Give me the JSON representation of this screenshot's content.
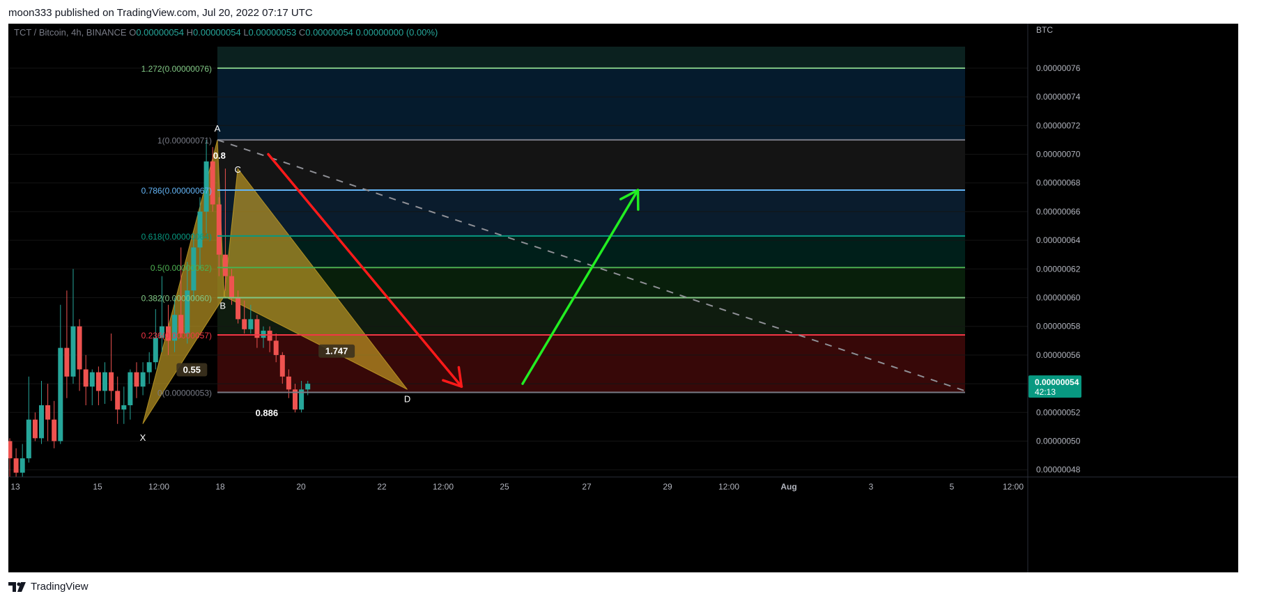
{
  "header": {
    "published": "moon333 published on TradingView.com, Jul 20, 2022 07:17 UTC"
  },
  "footer": {
    "brand": "TradingView"
  },
  "legend": {
    "symbol": "TCT / Bitcoin, 4h, BINANCE",
    "o_label": "O",
    "o_value": "0.00000054",
    "h_label": "H",
    "h_value": "0.00000054",
    "l_label": "L",
    "l_value": "0.00000053",
    "c_label": "C",
    "c_value": "0.00000054",
    "change": "0.00000000 (0.00%)"
  },
  "colors": {
    "up": "#26a69a",
    "down": "#ef5350",
    "pattern": "#c9a227",
    "arrow_down": "#ff1a1a",
    "arrow_up": "#22ee22"
  },
  "chart_data": {
    "type": "candlestick",
    "currency": "BTC",
    "ylim": [
      4.75e-07,
      7.75e-07
    ],
    "x_ticks": [
      "13",
      "15",
      "12:00",
      "18",
      "20",
      "22",
      "12:00",
      "25",
      "27",
      "29",
      "12:00",
      "Aug",
      "3",
      "5",
      "12:00"
    ],
    "y_ticks": [
      "0.00000076",
      "0.00000074",
      "0.00000072",
      "0.00000070",
      "0.00000068",
      "0.00000066",
      "0.00000064",
      "0.00000062",
      "0.00000060",
      "0.00000058",
      "0.00000056",
      "0.00000054",
      "0.00000052",
      "0.00000050",
      "0.00000048"
    ],
    "last_price": {
      "value": "0.00000054",
      "countdown": "42:13"
    },
    "fib_levels": [
      {
        "label": "1.272(0.00000076)",
        "value": 7.6e-07,
        "color": "#81c784"
      },
      {
        "label": "1(0.00000071)",
        "value": 7.1e-07,
        "color": "#787b86"
      },
      {
        "label": "0.786(0.00000067)",
        "value": 6.75e-07,
        "color": "#64b5f6"
      },
      {
        "label": "0.618(0.00000064)",
        "value": 6.43e-07,
        "color": "#089981"
      },
      {
        "label": "0.5(0.00000062)",
        "value": 6.21e-07,
        "color": "#4caf50"
      },
      {
        "label": "0.382(0.00000060)",
        "value": 6e-07,
        "color": "#81c784"
      },
      {
        "label": "0.236(0.00000057)",
        "value": 5.74e-07,
        "color": "#f23645"
      },
      {
        "label": "0(0.00000053)",
        "value": 5.34e-07,
        "color": "#787b86"
      }
    ],
    "pattern_points": [
      {
        "label": "X",
        "x": "Jul 16 04:00",
        "y": 5.12e-07
      },
      {
        "label": "A",
        "x": "Jul 18 00:00",
        "y": 7.1e-07
      },
      {
        "label": "B",
        "x": "Jul 18 04:00",
        "y": 6.01e-07
      },
      {
        "label": "C",
        "x": "Jul 18 12:00",
        "y": 6.9e-07
      },
      {
        "label": "D",
        "x": "Jul 22 16:00",
        "y": 5.36e-07
      }
    ],
    "ratios": [
      "0.8",
      "0.55",
      "1.747",
      "0.886"
    ],
    "candles": [
      {
        "o": 5e-07,
        "h": 5.02e-07,
        "l": 4.75e-07,
        "c": 4.88e-07
      },
      {
        "o": 4.88e-07,
        "h": 4.95e-07,
        "l": 4.75e-07,
        "c": 4.78e-07
      },
      {
        "o": 4.78e-07,
        "h": 4.98e-07,
        "l": 4.75e-07,
        "c": 4.88e-07
      },
      {
        "o": 4.88e-07,
        "h": 5.45e-07,
        "l": 4.85e-07,
        "c": 5.15e-07
      },
      {
        "o": 5.15e-07,
        "h": 5.2e-07,
        "l": 5e-07,
        "c": 5.02e-07
      },
      {
        "o": 5.02e-07,
        "h": 5.42e-07,
        "l": 4.98e-07,
        "c": 5.25e-07
      },
      {
        "o": 5.25e-07,
        "h": 5.4e-07,
        "l": 5e-07,
        "c": 5.15e-07
      },
      {
        "o": 5.15e-07,
        "h": 5.28e-07,
        "l": 4.95e-07,
        "c": 5e-07
      },
      {
        "o": 5e-07,
        "h": 5.95e-07,
        "l": 4.98e-07,
        "c": 5.65e-07
      },
      {
        "o": 5.65e-07,
        "h": 6.05e-07,
        "l": 5.3e-07,
        "c": 5.45e-07
      },
      {
        "o": 5.45e-07,
        "h": 6.2e-07,
        "l": 5.4e-07,
        "c": 5.8e-07
      },
      {
        "o": 5.8e-07,
        "h": 5.85e-07,
        "l": 5.35e-07,
        "c": 5.5e-07
      },
      {
        "o": 5.5e-07,
        "h": 5.6e-07,
        "l": 5.25e-07,
        "c": 5.38e-07
      },
      {
        "o": 5.38e-07,
        "h": 5.5e-07,
        "l": 5.25e-07,
        "c": 5.48e-07
      },
      {
        "o": 5.48e-07,
        "h": 5.52e-07,
        "l": 5.25e-07,
        "c": 5.35e-07
      },
      {
        "o": 5.35e-07,
        "h": 5.55e-07,
        "l": 5.26e-07,
        "c": 5.48e-07
      },
      {
        "o": 5.48e-07,
        "h": 5.75e-07,
        "l": 5.28e-07,
        "c": 5.35e-07
      },
      {
        "o": 5.35e-07,
        "h": 5.45e-07,
        "l": 5.12e-07,
        "c": 5.22e-07
      },
      {
        "o": 5.22e-07,
        "h": 5.38e-07,
        "l": 5.12e-07,
        "c": 5.25e-07
      },
      {
        "o": 5.25e-07,
        "h": 5.5e-07,
        "l": 5.15e-07,
        "c": 5.48e-07
      },
      {
        "o": 5.48e-07,
        "h": 5.55e-07,
        "l": 5.3e-07,
        "c": 5.38e-07
      },
      {
        "o": 5.38e-07,
        "h": 5.55e-07,
        "l": 5.32e-07,
        "c": 5.48e-07
      },
      {
        "o": 5.48e-07,
        "h": 5.62e-07,
        "l": 5.4e-07,
        "c": 5.55e-07
      },
      {
        "o": 5.55e-07,
        "h": 5.92e-07,
        "l": 5.5e-07,
        "c": 5.72e-07
      },
      {
        "o": 5.72e-07,
        "h": 6.15e-07,
        "l": 5.62e-07,
        "c": 5.8e-07
      },
      {
        "o": 5.8e-07,
        "h": 5.95e-07,
        "l": 5.6e-07,
        "c": 5.7e-07
      },
      {
        "o": 5.7e-07,
        "h": 6e-07,
        "l": 5.62e-07,
        "c": 5.88e-07
      },
      {
        "o": 5.88e-07,
        "h": 6.35e-07,
        "l": 5.72e-07,
        "c": 5.75e-07
      },
      {
        "o": 5.75e-07,
        "h": 6.25e-07,
        "l": 5.68e-07,
        "c": 6.05e-07
      },
      {
        "o": 6.05e-07,
        "h": 6.45e-07,
        "l": 5.98e-07,
        "c": 6.35e-07
      },
      {
        "o": 6.35e-07,
        "h": 6.7e-07,
        "l": 6.2e-07,
        "c": 6.6e-07
      },
      {
        "o": 6.6e-07,
        "h": 7.1e-07,
        "l": 6.45e-07,
        "c": 6.95e-07
      },
      {
        "o": 6.95e-07,
        "h": 7.05e-07,
        "l": 6.6e-07,
        "c": 6.65e-07
      },
      {
        "o": 6.65e-07,
        "h": 6.7e-07,
        "l": 6.15e-07,
        "c": 6.3e-07
      },
      {
        "o": 6.3e-07,
        "h": 6.9e-07,
        "l": 6.05e-07,
        "c": 6.15e-07
      },
      {
        "o": 6.15e-07,
        "h": 6.2e-07,
        "l": 5.95e-07,
        "c": 6e-07
      },
      {
        "o": 6e-07,
        "h": 6.05e-07,
        "l": 5.82e-07,
        "c": 5.85e-07
      },
      {
        "o": 5.85e-07,
        "h": 5.98e-07,
        "l": 5.75e-07,
        "c": 5.78e-07
      },
      {
        "o": 5.78e-07,
        "h": 5.95e-07,
        "l": 5.75e-07,
        "c": 5.85e-07
      },
      {
        "o": 5.85e-07,
        "h": 5.88e-07,
        "l": 5.65e-07,
        "c": 5.72e-07
      },
      {
        "o": 5.72e-07,
        "h": 5.8e-07,
        "l": 5.65e-07,
        "c": 5.77e-07
      },
      {
        "o": 5.77e-07,
        "h": 5.8e-07,
        "l": 5.62e-07,
        "c": 5.7e-07
      },
      {
        "o": 5.7e-07,
        "h": 5.75e-07,
        "l": 5.55e-07,
        "c": 5.6e-07
      },
      {
        "o": 5.6e-07,
        "h": 5.62e-07,
        "l": 5.4e-07,
        "c": 5.45e-07
      },
      {
        "o": 5.45e-07,
        "h": 5.5e-07,
        "l": 5.3e-07,
        "c": 5.36e-07
      },
      {
        "o": 5.36e-07,
        "h": 5.4e-07,
        "l": 5.2e-07,
        "c": 5.22e-07
      },
      {
        "o": 5.22e-07,
        "h": 5.42e-07,
        "l": 5.2e-07,
        "c": 5.36e-07
      },
      {
        "o": 5.36e-07,
        "h": 5.42e-07,
        "l": 5.32e-07,
        "c": 5.4e-07
      }
    ]
  }
}
